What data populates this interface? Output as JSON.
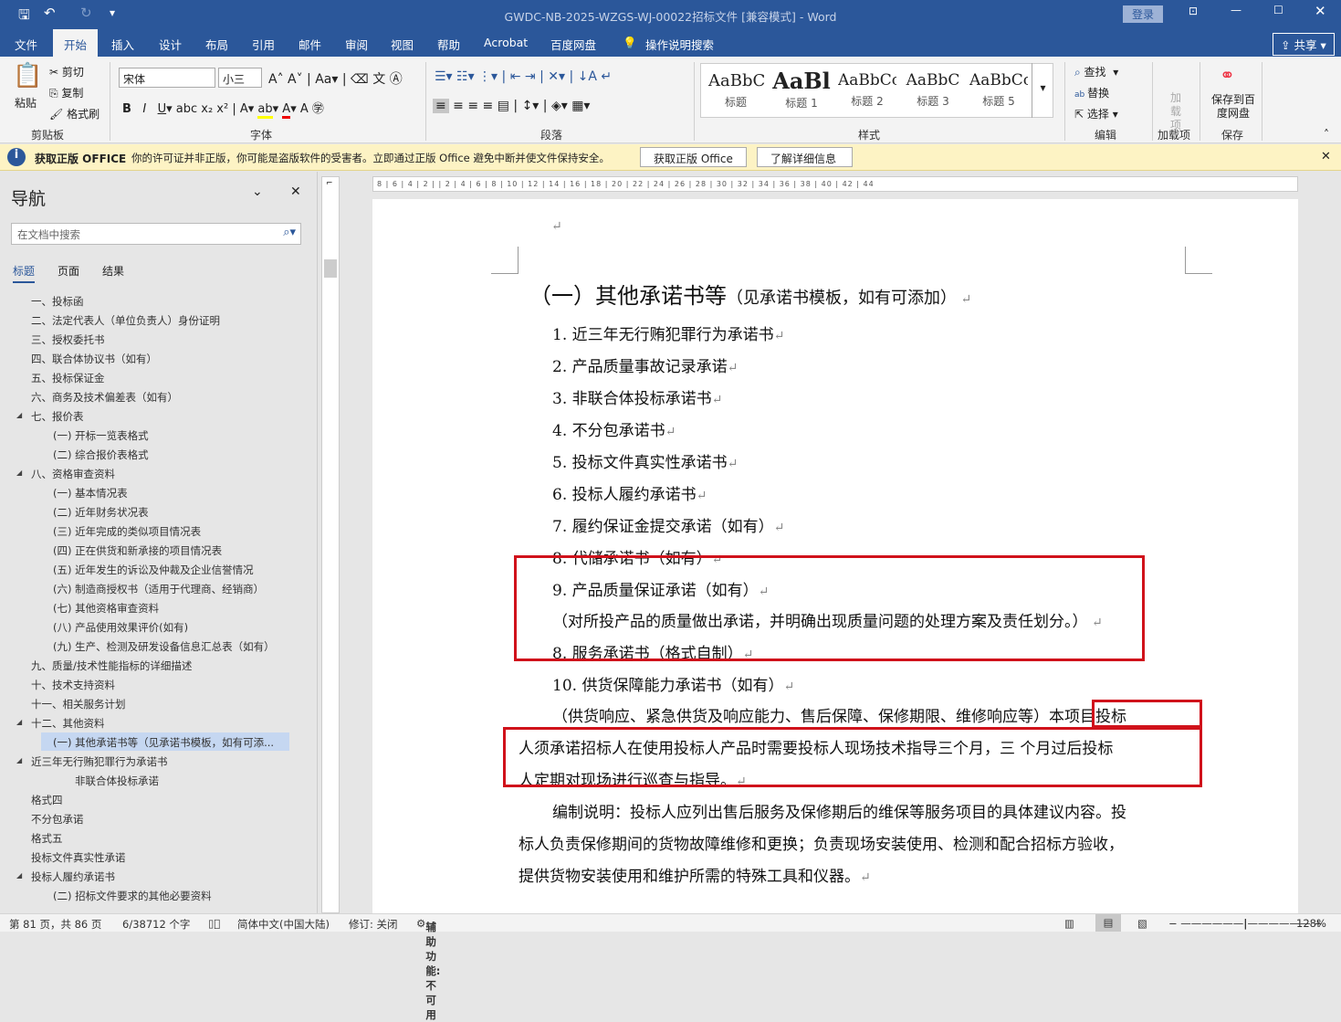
{
  "title": "GWDC-NB-2025-WZGS-WJ-00022招标文件 [兼容模式]  -  Word",
  "login": "登录",
  "tabs": [
    "文件",
    "开始",
    "插入",
    "设计",
    "布局",
    "引用",
    "邮件",
    "审阅",
    "视图",
    "帮助",
    "Acrobat",
    "百度网盘"
  ],
  "tell_me": "操作说明搜索",
  "share": "共享",
  "clipboard": {
    "paste": "粘贴",
    "cut": "剪切",
    "copy": "复制",
    "format_painter": "格式刷",
    "label": "剪贴板"
  },
  "font": {
    "name": "宋体",
    "size": "小三",
    "label": "字体"
  },
  "paragraph": {
    "label": "段落"
  },
  "styles": {
    "label": "样式",
    "items": [
      {
        "preview": "AaBbC",
        "name": "标题"
      },
      {
        "preview": "AaBl",
        "name": "标题 1"
      },
      {
        "preview": "AaBbCc",
        "name": "标题 2"
      },
      {
        "preview": "AaBbC",
        "name": "标题 3"
      },
      {
        "preview": "AaBbCc",
        "name": "标题 5"
      }
    ]
  },
  "editing": {
    "find": "查找",
    "replace": "替换",
    "select": "选择",
    "label": "编辑"
  },
  "addins": {
    "button": "加载项",
    "label": "加载项"
  },
  "save": {
    "button": "保存到百度网盘",
    "label": "保存"
  },
  "infobar": {
    "title": "获取正版 OFFICE",
    "message": "你的许可证并非正版，你可能是盗版软件的受害者。立即通过正版 Office 避免中断并使文件保持安全。",
    "btn1": "获取正版 Office",
    "btn2": "了解详细信息"
  },
  "nav": {
    "title": "导航",
    "search_placeholder": "在文档中搜索",
    "tabs": [
      "标题",
      "页面",
      "结果"
    ],
    "items": [
      {
        "text": "一、投标函",
        "level": 1
      },
      {
        "text": "二、法定代表人（单位负责人）身份证明",
        "level": 1
      },
      {
        "text": "三、授权委托书",
        "level": 1
      },
      {
        "text": "四、联合体协议书（如有）",
        "level": 1
      },
      {
        "text": "五、投标保证金",
        "level": 1
      },
      {
        "text": "六、商务及技术偏差表（如有）",
        "level": 1
      },
      {
        "text": "七、报价表",
        "level": 1,
        "expanded": true
      },
      {
        "text": "(一) 开标一览表格式",
        "level": 2
      },
      {
        "text": "(二) 综合报价表格式",
        "level": 2
      },
      {
        "text": "八、资格审查资料",
        "level": 1,
        "expanded": true
      },
      {
        "text": "(一) 基本情况表",
        "level": 2
      },
      {
        "text": "(二) 近年财务状况表",
        "level": 2
      },
      {
        "text": "(三) 近年完成的类似项目情况表",
        "level": 2
      },
      {
        "text": "(四) 正在供货和新承接的项目情况表",
        "level": 2
      },
      {
        "text": "(五) 近年发生的诉讼及仲裁及企业信誉情况",
        "level": 2
      },
      {
        "text": "(六) 制造商授权书（适用于代理商、经销商）",
        "level": 2
      },
      {
        "text": "(七) 其他资格审查资料",
        "level": 2
      },
      {
        "text": "(八) 产品使用效果评价(如有)",
        "level": 2
      },
      {
        "text": "(九) 生产、检测及研发设备信息汇总表（如有）",
        "level": 2
      },
      {
        "text": "九、质量/技术性能指标的详细描述",
        "level": 1
      },
      {
        "text": "十、技术支持资料",
        "level": 1
      },
      {
        "text": "十一、相关服务计划",
        "level": 1
      },
      {
        "text": "十二、其他资料",
        "level": 1,
        "expanded": true
      },
      {
        "text": "(一) 其他承诺书等（见承诺书模板，如有可添...",
        "level": 2,
        "selected": true
      },
      {
        "text": "近三年无行贿犯罪行为承诺书",
        "level": 1,
        "expanded": true
      },
      {
        "text": "非联合体投标承诺",
        "level": 3
      },
      {
        "text": "格式四",
        "level": 1
      },
      {
        "text": "不分包承诺",
        "level": 1
      },
      {
        "text": "格式五",
        "level": 1
      },
      {
        "text": "投标文件真实性承诺",
        "level": 1
      },
      {
        "text": "投标人履约承诺书",
        "level": 1,
        "expanded": true
      },
      {
        "text": "(二) 招标文件要求的其他必要资料",
        "level": 2
      }
    ]
  },
  "ruler": "8 | 6 | 4 | 2 |    | 2 | 4 | 6 | 8 | 10 | 12 | 14 | 16 | 18 | 20 | 22 | 24 | 26 | 28 | 30 | 32 | 34 | 36 | 38 | 40 | 42 | 44",
  "doc": {
    "heading_main": "（一）其他承诺书等",
    "heading_note": "（见承诺书模板，如有可添加）",
    "items": [
      "1. 近三年无行贿犯罪行为承诺书",
      "2. 产品质量事故记录承诺",
      "3. 非联合体投标承诺书",
      "4. 不分包承诺书",
      "5. 投标文件真实性承诺书",
      "6. 投标人履约承诺书",
      "7. 履约保证金提交承诺（如有）",
      "8. 代储承诺书（如有）",
      "9. 产品质量保证承诺（如有）"
    ],
    "p9": "（对所投产品的质量做出承诺，并明确出现质量问题的处理方案及责任划分。）",
    "item8b": "8. 服务承诺书（格式自制）",
    "item10": "10. 供货保障能力承诺书（如有）",
    "p10a": "（供货响应、紧急供货及响应能力、售后保障、保修期限、维修响应等）",
    "p10b": "本项目投标",
    "p10c": "人须承诺招标人在使用投标人产品时需要投标人现场技术指导三个月，三  个月过后投标",
    "p10d": "人定期对现场进行巡查与指导。",
    "note1": "编制说明：投标人应列出售后服务及保修期后的维保等服务项目的具体建议内容。投",
    "note2": "标人负责保修期间的货物故障维修和更换；负责现场安装使用、检测和配合招标方验收，",
    "note3": "提供货物安装使用和维护所需的特殊工具和仪器。"
  },
  "status": {
    "page": "第 81 页，共 86 页",
    "words": "6/38712 个字",
    "lang": "简体中文(中国大陆)",
    "track": "修订: 关闭",
    "access": "辅助功能: 不可用",
    "zoom": "128%"
  },
  "colors": {
    "brand": "#2b579a",
    "highlight": "#d0121b"
  }
}
